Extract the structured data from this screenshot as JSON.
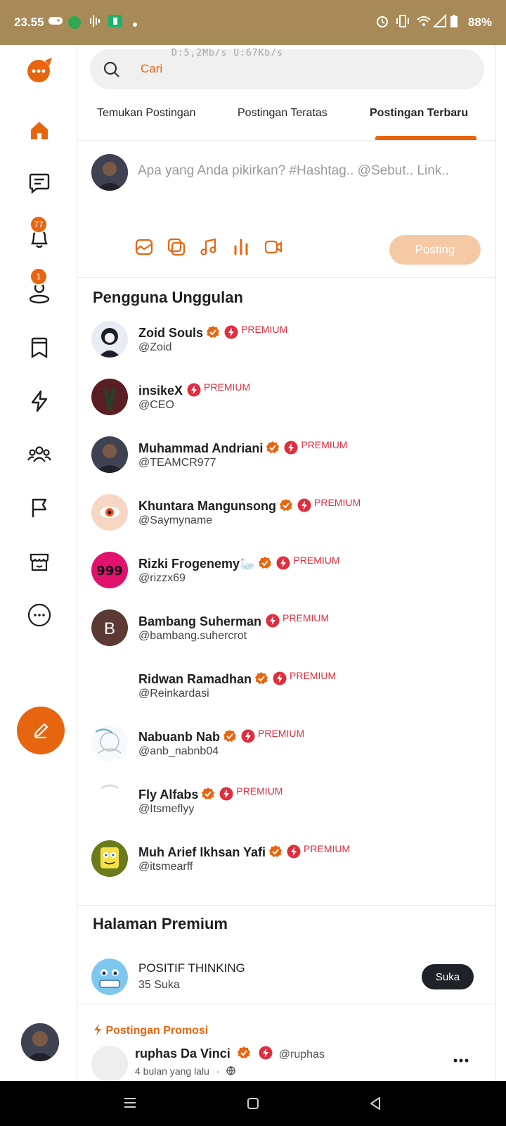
{
  "status": {
    "time": "23.55",
    "battery": "88%"
  },
  "search": {
    "placeholder": "Cari",
    "netspeed": "D:5,2Mb/s   U:67Kb/s"
  },
  "tabs": [
    {
      "label": "Temukan Postingan"
    },
    {
      "label": "Postingan Teratas"
    },
    {
      "label": "Postingan Terbaru",
      "active": true
    }
  ],
  "composer": {
    "placeholder": "Apa yang Anda pikirkan? #Hashtag.. @Sebut.. Link..",
    "post_label": "Posting"
  },
  "sidebar": {
    "notifications_badge": "77",
    "requests_badge": "1"
  },
  "featured": {
    "title": "Pengguna Unggulan",
    "premium_label": "PREMIUM",
    "users": [
      {
        "name": "Zoid Souls",
        "handle": "@Zoid",
        "verified": true
      },
      {
        "name": "insikeX",
        "handle": "@CEO",
        "verified": false
      },
      {
        "name": "Muhammad Andriani",
        "handle": "@TEAMCR977",
        "verified": true
      },
      {
        "name": "Khuntara Mangunsong",
        "handle": "@Saymyname",
        "verified": true
      },
      {
        "name": "Rizki Frogenemy🦢",
        "handle": "@rizzx69",
        "verified": true
      },
      {
        "name": "Bambang Suherman",
        "handle": "@bambang.suhercrot",
        "verified": false,
        "initial": "B"
      },
      {
        "name": "Ridwan Ramadhan",
        "handle": "@Reinkardasi",
        "verified": true
      },
      {
        "name": "Nabuanb Nab",
        "handle": "@anb_nabnb04",
        "verified": true
      },
      {
        "name": "Fly Alfabs",
        "handle": "@Itsmeflyy",
        "verified": true
      },
      {
        "name": "Muh Arief Ikhsan Yafi",
        "handle": "@itsmearff",
        "verified": true
      }
    ]
  },
  "premium_pages": {
    "title": "Halaman Premium",
    "page_name": "POSITIF THINKING",
    "likes": "35 Suka",
    "like_label": "Suka"
  },
  "promo": {
    "label": "Postingan Promosi",
    "author": "ruphas Da Vinci",
    "handle": "@ruphas",
    "time": "4 bulan yang lalu",
    "separator": "·"
  },
  "colors": {
    "accent": "#e8650f",
    "premium": "#e02e3e",
    "statusbar": "#a88a58"
  }
}
